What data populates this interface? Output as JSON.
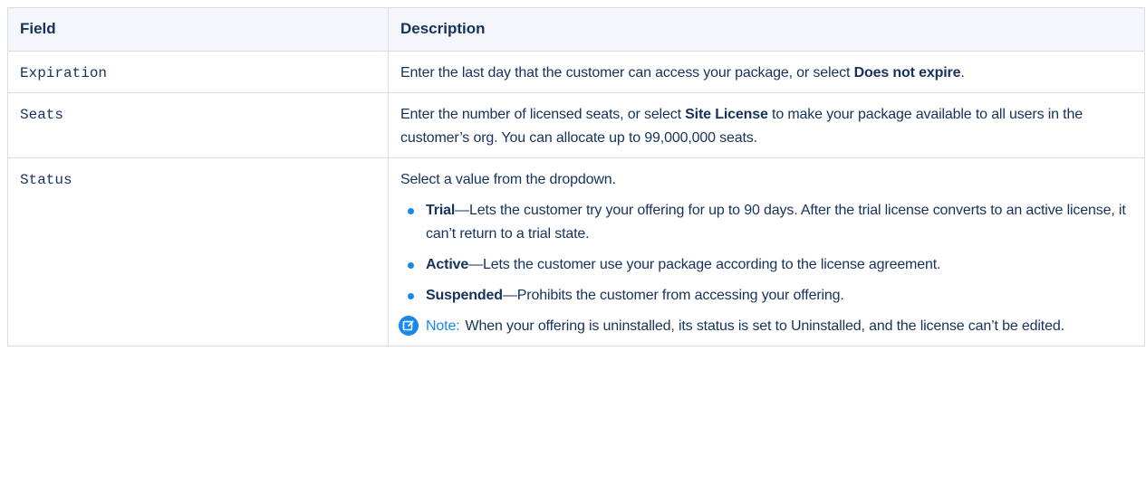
{
  "table": {
    "headers": {
      "field": "Field",
      "description": "Description"
    },
    "rows": [
      {
        "field": "Expiration",
        "desc": {
          "before": "Enter the last day that the customer can access your package, or select ",
          "bold": "Does not expire",
          "after": "."
        }
      },
      {
        "field": "Seats",
        "desc": {
          "before": "Enter the number of licensed seats, or select ",
          "bold": "Site License",
          "after": " to make your package available to all users in the customer’s org. You can allocate up to 99,000,000 seats."
        }
      },
      {
        "field": "Status",
        "intro": "Select a value from the dropdown.",
        "items": [
          {
            "term": "Trial",
            "text": "—Lets the customer try your offering for up to 90 days. After the trial license converts to an active license, it can’t return to a trial state."
          },
          {
            "term": "Active",
            "text": "—Lets the customer use your package according to the license agreement."
          },
          {
            "term": "Suspended",
            "text": "—Prohibits the customer from accessing your offering."
          }
        ],
        "note": {
          "label": "Note:",
          "text": "When your offering is uninstalled, its status is set to Uninstalled, and the license can’t be edited.",
          "icon": "edit-icon"
        }
      }
    ]
  },
  "colors": {
    "accent": "#1589ee",
    "text": "#16325c",
    "border": "#d8dde6",
    "header_bg": "#f4f6f9"
  }
}
